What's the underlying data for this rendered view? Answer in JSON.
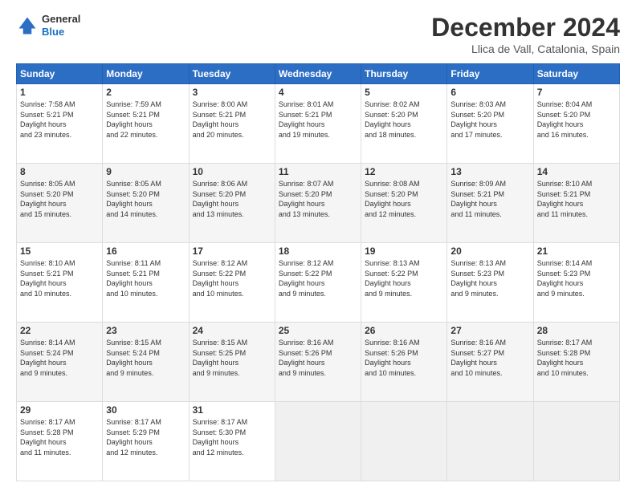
{
  "header": {
    "logo": {
      "general": "General",
      "blue": "Blue"
    },
    "title": "December 2024",
    "location": "Llica de Vall, Catalonia, Spain"
  },
  "calendar": {
    "days_of_week": [
      "Sunday",
      "Monday",
      "Tuesday",
      "Wednesday",
      "Thursday",
      "Friday",
      "Saturday"
    ],
    "weeks": [
      [
        null,
        {
          "day": "2",
          "sunrise": "7:59 AM",
          "sunset": "5:21 PM",
          "daylight": "9 hours and 22 minutes."
        },
        {
          "day": "3",
          "sunrise": "8:00 AM",
          "sunset": "5:21 PM",
          "daylight": "9 hours and 20 minutes."
        },
        {
          "day": "4",
          "sunrise": "8:01 AM",
          "sunset": "5:21 PM",
          "daylight": "9 hours and 19 minutes."
        },
        {
          "day": "5",
          "sunrise": "8:02 AM",
          "sunset": "5:20 PM",
          "daylight": "9 hours and 18 minutes."
        },
        {
          "day": "6",
          "sunrise": "8:03 AM",
          "sunset": "5:20 PM",
          "daylight": "9 hours and 17 minutes."
        },
        {
          "day": "7",
          "sunrise": "8:04 AM",
          "sunset": "5:20 PM",
          "daylight": "9 hours and 16 minutes."
        }
      ],
      [
        {
          "day": "1",
          "sunrise": "7:58 AM",
          "sunset": "5:21 PM",
          "daylight": "9 hours and 23 minutes."
        },
        {
          "day": "9",
          "sunrise": "8:05 AM",
          "sunset": "5:20 PM",
          "daylight": "9 hours and 14 minutes."
        },
        {
          "day": "10",
          "sunrise": "8:06 AM",
          "sunset": "5:20 PM",
          "daylight": "9 hours and 13 minutes."
        },
        {
          "day": "11",
          "sunrise": "8:07 AM",
          "sunset": "5:20 PM",
          "daylight": "9 hours and 13 minutes."
        },
        {
          "day": "12",
          "sunrise": "8:08 AM",
          "sunset": "5:20 PM",
          "daylight": "9 hours and 12 minutes."
        },
        {
          "day": "13",
          "sunrise": "8:09 AM",
          "sunset": "5:21 PM",
          "daylight": "9 hours and 11 minutes."
        },
        {
          "day": "14",
          "sunrise": "8:10 AM",
          "sunset": "5:21 PM",
          "daylight": "9 hours and 11 minutes."
        }
      ],
      [
        {
          "day": "8",
          "sunrise": "8:05 AM",
          "sunset": "5:20 PM",
          "daylight": "9 hours and 15 minutes."
        },
        {
          "day": "16",
          "sunrise": "8:11 AM",
          "sunset": "5:21 PM",
          "daylight": "9 hours and 10 minutes."
        },
        {
          "day": "17",
          "sunrise": "8:12 AM",
          "sunset": "5:22 PM",
          "daylight": "9 hours and 10 minutes."
        },
        {
          "day": "18",
          "sunrise": "8:12 AM",
          "sunset": "5:22 PM",
          "daylight": "9 hours and 9 minutes."
        },
        {
          "day": "19",
          "sunrise": "8:13 AM",
          "sunset": "5:22 PM",
          "daylight": "9 hours and 9 minutes."
        },
        {
          "day": "20",
          "sunrise": "8:13 AM",
          "sunset": "5:23 PM",
          "daylight": "9 hours and 9 minutes."
        },
        {
          "day": "21",
          "sunrise": "8:14 AM",
          "sunset": "5:23 PM",
          "daylight": "9 hours and 9 minutes."
        }
      ],
      [
        {
          "day": "15",
          "sunrise": "8:10 AM",
          "sunset": "5:21 PM",
          "daylight": "9 hours and 10 minutes."
        },
        {
          "day": "23",
          "sunrise": "8:15 AM",
          "sunset": "5:24 PM",
          "daylight": "9 hours and 9 minutes."
        },
        {
          "day": "24",
          "sunrise": "8:15 AM",
          "sunset": "5:25 PM",
          "daylight": "9 hours and 9 minutes."
        },
        {
          "day": "25",
          "sunrise": "8:16 AM",
          "sunset": "5:26 PM",
          "daylight": "9 hours and 9 minutes."
        },
        {
          "day": "26",
          "sunrise": "8:16 AM",
          "sunset": "5:26 PM",
          "daylight": "9 hours and 10 minutes."
        },
        {
          "day": "27",
          "sunrise": "8:16 AM",
          "sunset": "5:27 PM",
          "daylight": "9 hours and 10 minutes."
        },
        {
          "day": "28",
          "sunrise": "8:17 AM",
          "sunset": "5:28 PM",
          "daylight": "9 hours and 10 minutes."
        }
      ],
      [
        {
          "day": "22",
          "sunrise": "8:14 AM",
          "sunset": "5:24 PM",
          "daylight": "9 hours and 9 minutes."
        },
        {
          "day": "30",
          "sunrise": "8:17 AM",
          "sunset": "5:29 PM",
          "daylight": "9 hours and 12 minutes."
        },
        {
          "day": "31",
          "sunrise": "8:17 AM",
          "sunset": "5:30 PM",
          "daylight": "9 hours and 12 minutes."
        },
        null,
        null,
        null,
        null
      ],
      [
        {
          "day": "29",
          "sunrise": "8:17 AM",
          "sunset": "5:28 PM",
          "daylight": "9 hours and 11 minutes."
        },
        null,
        null,
        null,
        null,
        null,
        null
      ]
    ]
  }
}
